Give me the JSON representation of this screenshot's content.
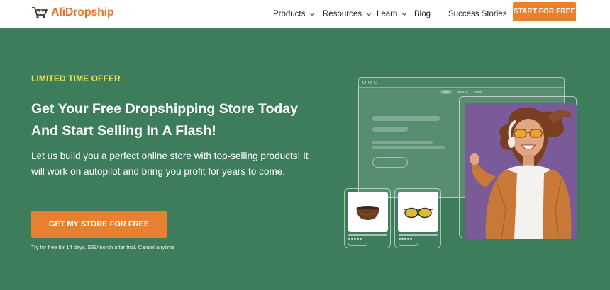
{
  "brand": {
    "name_part1": "Ali",
    "name_part2": "Dropship",
    "accent": "#e7812f"
  },
  "nav": {
    "items": [
      {
        "label": "Products",
        "has_dropdown": true
      },
      {
        "label": "Resources",
        "has_dropdown": true
      },
      {
        "label": "Learn",
        "has_dropdown": true
      },
      {
        "label": "Blog",
        "has_dropdown": false
      },
      {
        "label": "Success Stories",
        "has_dropdown": false
      }
    ],
    "cta": "START FOR FREE"
  },
  "hero": {
    "eyebrow": "LIMITED TIME OFFER",
    "title_line1": "Get Your Free Dropshipping Store Today",
    "title_line2": "And Start Selling In A Flash!",
    "description": "Let us build you a perfect online store with top-selling products! It will work on autopilot and bring you profit for years to come.",
    "cta": "GET MY STORE FOR FREE",
    "fine_print": "Try for free for 14 days. $39/month after trial. Cancel anytime",
    "background": "#3e7d5c",
    "eyebrow_color": "#f3e24b"
  },
  "illustration": {
    "mini_nav": [
      "Shop",
      "About Us",
      "Contact"
    ],
    "products": [
      "bowl-icon",
      "sunglasses-icon"
    ]
  }
}
